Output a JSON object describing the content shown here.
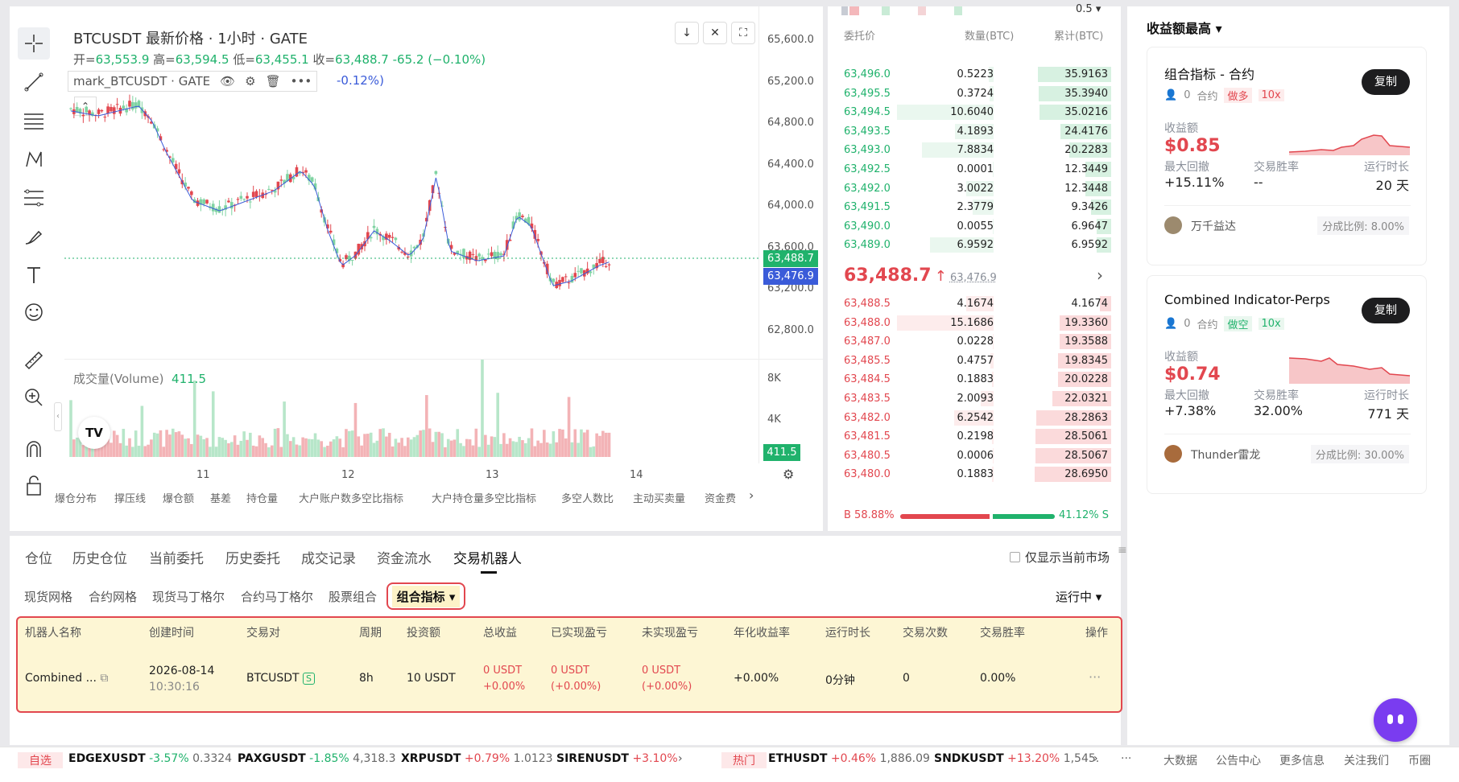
{
  "chart": {
    "title": "BTCUSDT 最新价格 · 1小时 · GATE",
    "ohlc": {
      "open_label": "开=",
      "open": "63,553.9",
      "high_label": "高=",
      "high": "63,594.5",
      "low_label": "低=",
      "low": "63,455.1",
      "close_label": "收=",
      "close": "63,488.7",
      "change": "-65.2 (−0.10%)"
    },
    "mark_label": "mark_BTCUSDT · GATE",
    "mark_change": "-0.12%)",
    "yaxis": [
      "65,600.0",
      "65,200.0",
      "64,800.0",
      "64,400.0",
      "64,000.0",
      "63,600.0",
      "63,200.0",
      "62,800.0"
    ],
    "last_price_tag": "63,488.7",
    "mark_price_tag": "63,476.9",
    "volume_label": "成交量(Volume)",
    "volume_value": "411.5",
    "volume_axis": [
      "8K",
      "4K"
    ],
    "volume_tag": "411.5",
    "xaxis": [
      "11",
      "12",
      "13",
      "14"
    ],
    "logo": "TV",
    "colors": {
      "up": "#7fd3a2",
      "down": "#e2474f"
    }
  },
  "indicators": [
    "爆仓分布",
    "撑压线",
    "爆仓额",
    "基差",
    "持仓量",
    "大户账户数多空比指标",
    "大户持仓量多空比指标",
    "多空人数比",
    "主动买卖量",
    "资金费"
  ],
  "orderbook": {
    "top_values": [
      "0.5"
    ],
    "headers": {
      "price": "委托价",
      "qty": "数量(BTC)",
      "cum": "累计(BTC)"
    },
    "asks": [
      {
        "p": "63,496.0",
        "q": "0.5223",
        "c": "35.9163",
        "qf": 0.05,
        "cf": 0.96
      },
      {
        "p": "63,495.5",
        "q": "0.3724",
        "c": "35.3940",
        "qf": 0.04,
        "cf": 0.95
      },
      {
        "p": "63,494.5",
        "q": "10.6040",
        "c": "35.0216",
        "qf": 1.0,
        "cf": 0.94
      },
      {
        "p": "63,493.5",
        "q": "4.1893",
        "c": "24.4176",
        "qf": 0.4,
        "cf": 0.66
      },
      {
        "p": "63,493.0",
        "q": "7.8834",
        "c": "20.2283",
        "qf": 0.74,
        "cf": 0.55
      },
      {
        "p": "63,492.5",
        "q": "0.0001",
        "c": "12.3449",
        "qf": 0.01,
        "cf": 0.34
      },
      {
        "p": "63,492.0",
        "q": "3.0022",
        "c": "12.3448",
        "qf": 0.28,
        "cf": 0.34
      },
      {
        "p": "63,491.5",
        "q": "2.3779",
        "c": "9.3426",
        "qf": 0.22,
        "cf": 0.26
      },
      {
        "p": "63,490.0",
        "q": "0.0055",
        "c": "6.9647",
        "qf": 0.01,
        "cf": 0.19
      },
      {
        "p": "63,489.0",
        "q": "6.9592",
        "c": "6.9592",
        "qf": 0.66,
        "cf": 0.19
      }
    ],
    "mid_price": "63,488.7",
    "mid_arrow": "↑",
    "mid_mark": "63,476.9",
    "bids": [
      {
        "p": "63,488.5",
        "q": "4.1674",
        "c": "4.1674",
        "qf": 0.28,
        "cf": 0.15
      },
      {
        "p": "63,488.0",
        "q": "15.1686",
        "c": "19.3360",
        "qf": 1.0,
        "cf": 0.67
      },
      {
        "p": "63,487.0",
        "q": "0.0228",
        "c": "19.3588",
        "qf": 0.01,
        "cf": 0.67
      },
      {
        "p": "63,485.5",
        "q": "0.4757",
        "c": "19.8345",
        "qf": 0.03,
        "cf": 0.69
      },
      {
        "p": "63,484.5",
        "q": "0.1883",
        "c": "20.0228",
        "qf": 0.02,
        "cf": 0.7
      },
      {
        "p": "63,483.5",
        "q": "2.0093",
        "c": "22.0321",
        "qf": 0.13,
        "cf": 0.77
      },
      {
        "p": "63,482.0",
        "q": "6.2542",
        "c": "28.2863",
        "qf": 0.41,
        "cf": 0.98
      },
      {
        "p": "63,481.5",
        "q": "0.2198",
        "c": "28.5061",
        "qf": 0.02,
        "cf": 0.99
      },
      {
        "p": "63,480.5",
        "q": "0.0006",
        "c": "28.5067",
        "qf": 0.01,
        "cf": 0.99
      },
      {
        "p": "63,480.0",
        "q": "0.1883",
        "c": "28.6950",
        "qf": 0.02,
        "cf": 1.0
      }
    ],
    "buy_ratio_label": "B 58.88%",
    "sell_ratio_label": "41.12% S",
    "buy_ratio": 0.5888
  },
  "bottom": {
    "tabs": [
      "仓位",
      "历史仓位",
      "当前委托",
      "历史委托",
      "成交记录",
      "资金流水",
      "交易机器人"
    ],
    "only_current": "仅显示当前市场",
    "subtabs": [
      "现货网格",
      "合约网格",
      "现货马丁格尔",
      "合约马丁格尔",
      "股票组合",
      "组合指标"
    ],
    "status_filter": "运行中",
    "headers": [
      "机器人名称",
      "创建时间",
      "交易对",
      "周期",
      "投资额",
      "总收益",
      "已实现盈亏",
      "未实现盈亏",
      "年化收益率",
      "运行时长",
      "交易次数",
      "交易胜率",
      "操作"
    ],
    "row": {
      "name": "Combined ...",
      "date": "2026-08-14",
      "time": "10:30:16",
      "pair": "BTCUSDT",
      "pair_badge": "S",
      "period": "8h",
      "invest": "10 USDT",
      "total": "0 USDT",
      "total_pct": "+0.00%",
      "realized": "0 USDT",
      "realized_pct": "(+0.00%)",
      "unrealized": "0 USDT",
      "unrealized_pct": "(+0.00%)",
      "annual": "+0.00%",
      "duration": "0分钟",
      "trades": "0",
      "winrate": "0.00%",
      "more": "···"
    }
  },
  "right": {
    "title": "收益额最高",
    "cards": [
      {
        "name": "组合指标 - 合约",
        "users": "0",
        "type": "合约",
        "side": "做多",
        "lev": "10x",
        "copy": "复制",
        "profit_label": "收益额",
        "profit": "$0.85",
        "dd_label": "最大回撤",
        "dd": "+15.11%",
        "win_label": "交易胜率",
        "win": "--",
        "dur_label": "运行时长",
        "dur": "20 天",
        "author": "万千益达",
        "share": "分成比例: 8.00%"
      },
      {
        "name": "Combined Indicator-Perps",
        "users": "0",
        "type": "合约",
        "side": "做空",
        "lev": "10x",
        "copy": "复制",
        "profit_label": "收益额",
        "profit": "$0.74",
        "dd_label": "最大回撤",
        "dd": "+7.38%",
        "win_label": "交易胜率",
        "win": "32.00%",
        "dur_label": "运行时长",
        "dur": "771 天",
        "author": "Thunder雷龙",
        "share": "分成比例: 30.00%"
      }
    ]
  },
  "ticker": {
    "fav": "自选",
    "items": [
      {
        "s": "EDGEXUSDT",
        "c": "-3.57%",
        "p": "0.3324"
      },
      {
        "s": "PAXGUSDT",
        "c": "-1.85%",
        "p": "4,318.3"
      },
      {
        "s": "XRPUSDT",
        "c": "+0.79%",
        "p": "1.0123"
      },
      {
        "s": "SIRENUSDT",
        "c": "+3.10%",
        "p": ""
      }
    ],
    "hot": "热门",
    "hot_items": [
      {
        "s": "ETHUSDT",
        "c": "+0.46%",
        "p": "1,886.09"
      },
      {
        "s": "SNDKUSDT",
        "c": "+13.20%",
        "p": "1,545."
      }
    ],
    "more": "···",
    "links": [
      "大数据",
      "公告中心",
      "更多信息",
      "关注我们",
      "币圈"
    ]
  }
}
